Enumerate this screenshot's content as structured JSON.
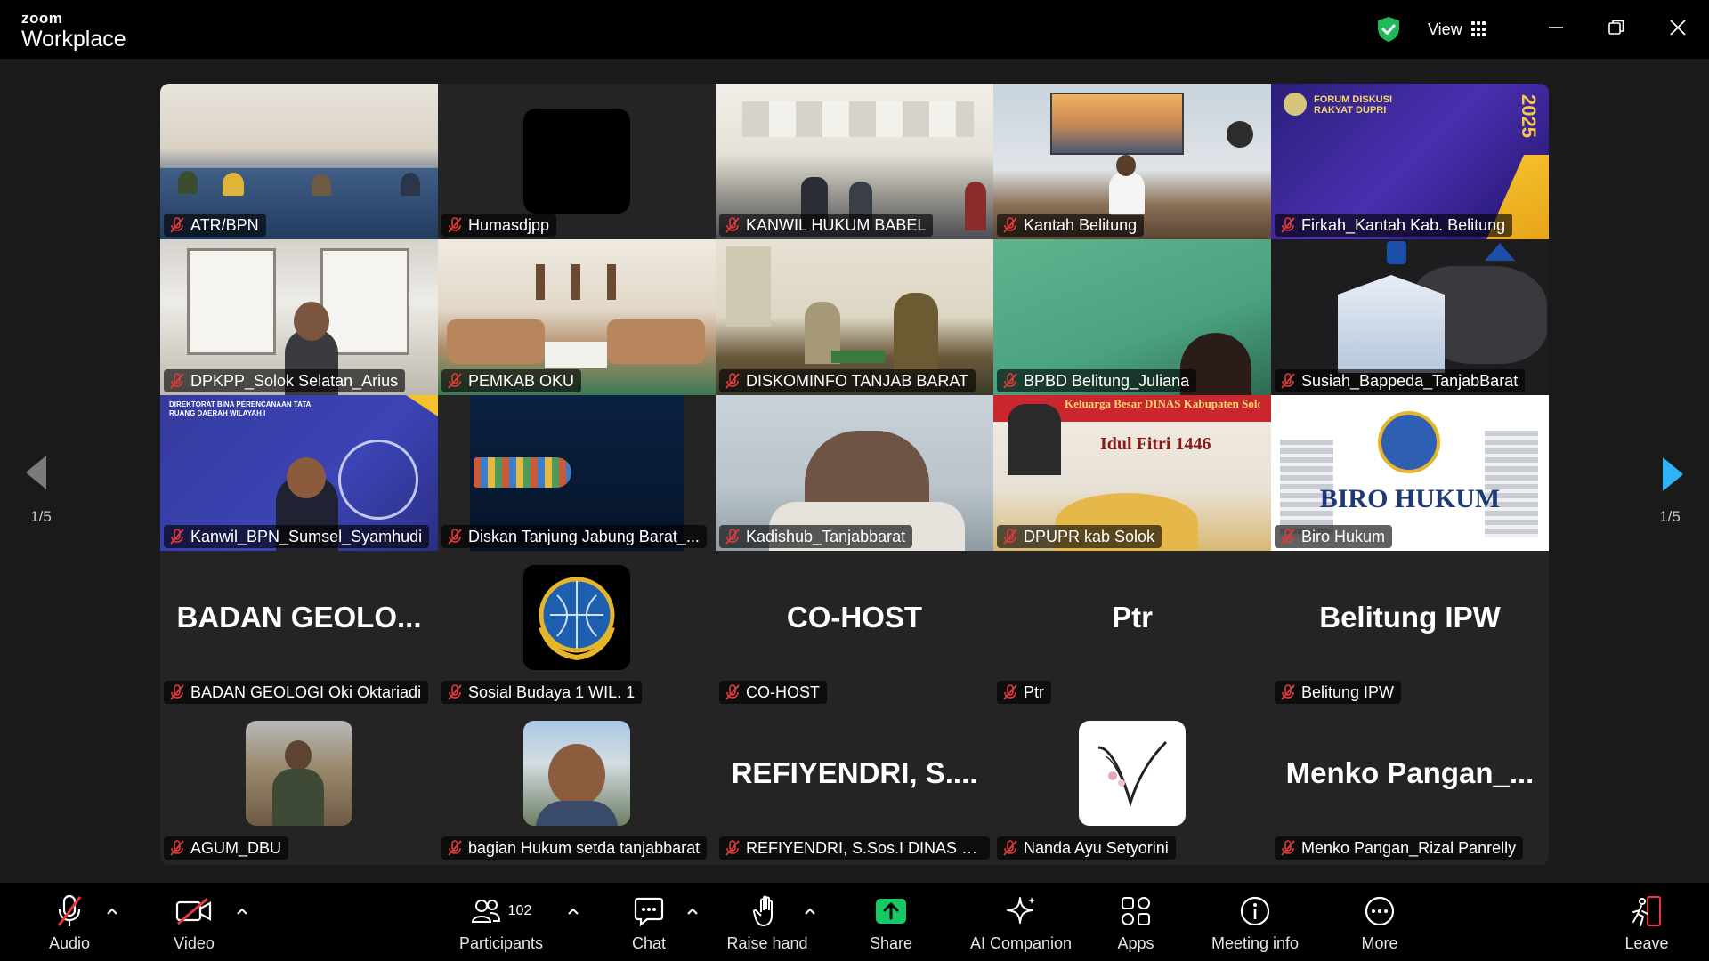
{
  "app": {
    "brand_small": "zoom",
    "brand_big": "Workplace"
  },
  "titlebar": {
    "view_label": "View"
  },
  "pagination": {
    "left": "1/5",
    "right": "1/5"
  },
  "tiles": [
    {
      "name": "ATR/BPN"
    },
    {
      "name": "Humasdjpp"
    },
    {
      "name": "KANWIL HUKUM BABEL"
    },
    {
      "name": "Kantah Belitung"
    },
    {
      "name": "Firkah_Kantah Kab. Belitung"
    },
    {
      "name": "DPKPP_Solok Selatan_Arius"
    },
    {
      "name": "PEMKAB OKU"
    },
    {
      "name": "DISKOMINFO TANJAB BARAT"
    },
    {
      "name": "BPBD Belitung_Juliana"
    },
    {
      "name": "Susiah_Bappeda_TanjabBarat"
    },
    {
      "name": "Kanwil_BPN_Sumsel_Syamhudi"
    },
    {
      "name": "Diskan Tanjung Jabung Barat_..."
    },
    {
      "name": "Kadishub_Tanjabbarat"
    },
    {
      "name": "DPUPR kab Solok"
    },
    {
      "name": "Biro Hukum"
    },
    {
      "name": "BADAN GEOLOGI Oki Oktariadi",
      "big": "BADAN  GEOLO..."
    },
    {
      "name": "Sosial Budaya 1 WIL. 1"
    },
    {
      "name": "CO-HOST",
      "big": "CO-HOST"
    },
    {
      "name": "Ptr",
      "big": "Ptr"
    },
    {
      "name": "Belitung IPW",
      "big": "Belitung IPW"
    },
    {
      "name": "AGUM_DBU"
    },
    {
      "name": "bagian Hukum setda tanjabbarat"
    },
    {
      "name": "REFIYENDRI, S.Sos.I DINAS SOSI...",
      "big": "REFIYENDRI,  S...."
    },
    {
      "name": "Nanda Ayu Setyorini"
    },
    {
      "name": "Menko Pangan_Rizal Panrelly",
      "big": "Menko  Pangan_..."
    }
  ],
  "tile_overlay_text": {
    "forum": "FORUM DISKUSI RAKYAT DUPRI",
    "year": "2025",
    "direktorat": "DIREKTORAT BINA PERENCANAAN TATA RUANG DAERAH WILAYAH I",
    "keluarga": "Keluarga Besar DINAS Kabupaten Solok",
    "idul": "Idul Fitri 1446",
    "biro": "BIRO HUKUM"
  },
  "toolbar": {
    "audio": "Audio",
    "video": "Video",
    "participants": "Participants",
    "participants_count": "102",
    "chat": "Chat",
    "raise_hand": "Raise hand",
    "share": "Share",
    "ai_companion": "AI Companion",
    "apps": "Apps",
    "meeting_info": "Meeting info",
    "more": "More",
    "leave": "Leave"
  },
  "colors": {
    "shield": "#1fb85a",
    "share": "#17c964",
    "muted": "#e23a3a",
    "leave": "#e23a3a",
    "nav_arrow": "#2fb5f5"
  },
  "icons": [
    "shield-icon",
    "grid-icon",
    "minimize-icon",
    "restore-icon",
    "close-icon",
    "mic-off-icon",
    "video-off-icon",
    "participants-icon",
    "chat-icon",
    "hand-icon",
    "share-icon",
    "sparkle-icon",
    "apps-icon",
    "info-icon",
    "more-icon",
    "leave-icon"
  ]
}
